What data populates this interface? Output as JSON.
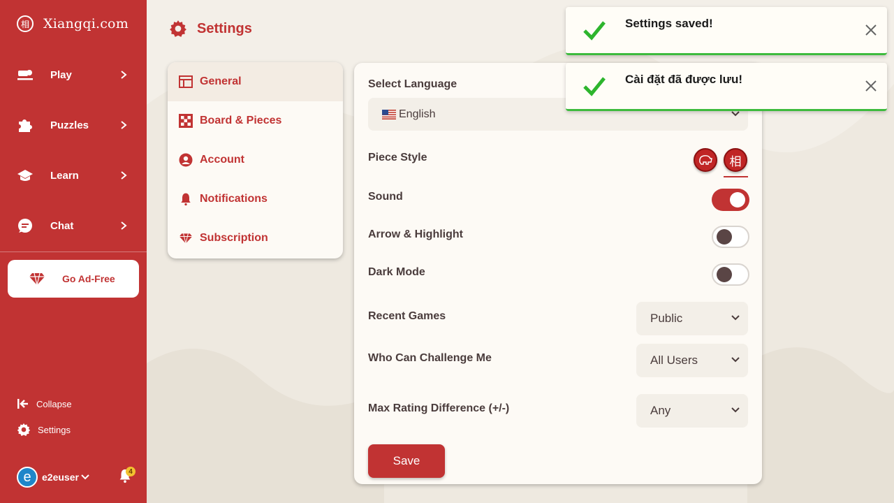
{
  "brand": {
    "name": "Xiangqi.com",
    "logo_char": "相"
  },
  "sidebar": {
    "items": [
      {
        "label": "Play",
        "icon": "play-icon"
      },
      {
        "label": "Puzzles",
        "icon": "puzzle-icon"
      },
      {
        "label": "Learn",
        "icon": "graduation-cap-icon"
      },
      {
        "label": "Chat",
        "icon": "chat-icon"
      }
    ],
    "ad_free": "Go Ad-Free",
    "collapse": "Collapse",
    "settings": "Settings",
    "user": {
      "avatar_letter": "e",
      "name": "e2euser",
      "notification_count": "4"
    }
  },
  "page": {
    "title": "Settings"
  },
  "settings_menu": [
    {
      "label": "General",
      "icon": "layout-icon",
      "active": true
    },
    {
      "label": "Board & Pieces",
      "icon": "checkerboard-icon",
      "active": false
    },
    {
      "label": "Account",
      "icon": "user-circle-icon",
      "active": false
    },
    {
      "label": "Notifications",
      "icon": "bell-icon",
      "active": false
    },
    {
      "label": "Subscription",
      "icon": "diamond-icon",
      "active": false
    }
  ],
  "general": {
    "language_label": "Select Language",
    "language_value": "English",
    "piece_style_label": "Piece Style",
    "piece_style_selected_char": "相",
    "sound_label": "Sound",
    "sound_on": true,
    "arrow_label": "Arrow & Highlight",
    "arrow_on": false,
    "dark_label": "Dark Mode",
    "dark_on": false,
    "recent_games_label": "Recent Games",
    "recent_games_value": "Public",
    "challenge_label": "Who Can Challenge Me",
    "challenge_value": "All Users",
    "rating_diff_label": "Max Rating Difference (+/-)",
    "rating_diff_value": "Any",
    "save_label": "Save"
  },
  "toasts": [
    {
      "message": "Settings saved!"
    },
    {
      "message": "Cài đặt đã được lưu!"
    }
  ],
  "colors": {
    "accent": "#c13333",
    "success": "#3dbb3d",
    "background": "#f3efe8"
  }
}
